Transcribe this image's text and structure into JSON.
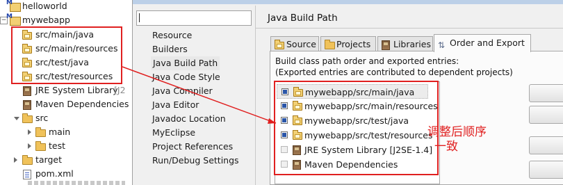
{
  "explorer": {
    "items": [
      {
        "label": "helloworld",
        "icon": "project-icon"
      },
      {
        "label": "mywebapp",
        "icon": "maven-project-icon"
      },
      {
        "label": "src/main/java",
        "icon": "source-folder-icon"
      },
      {
        "label": "src/main/resources",
        "icon": "source-folder-icon"
      },
      {
        "label": "src/test/java",
        "icon": "source-folder-icon"
      },
      {
        "label": "src/test/resources",
        "icon": "source-folder-icon"
      },
      {
        "label": "JRE System Library",
        "suffix": "[J2",
        "icon": "library-icon"
      },
      {
        "label": "Maven Dependencies",
        "icon": "maven-library-icon"
      },
      {
        "label": "src",
        "icon": "folder-icon"
      },
      {
        "label": "main",
        "icon": "folder-icon"
      },
      {
        "label": "test",
        "icon": "folder-icon"
      },
      {
        "label": "target",
        "icon": "folder-icon"
      },
      {
        "label": "pom.xml",
        "icon": "xml-file-icon"
      }
    ]
  },
  "dialog": {
    "filter_value": "",
    "nav": [
      "Resource",
      "Builders",
      "Java Build Path",
      "Java Code Style",
      "Java Compiler",
      "Java Editor",
      "Javadoc Location",
      "MyEclipse",
      "Project References",
      "Run/Debug Settings"
    ],
    "selected_nav": "Java Build Path",
    "heading": "Java Build Path",
    "tabs": [
      "Source",
      "Projects",
      "Libraries",
      "Order and Export"
    ],
    "active_tab": "Order and Export",
    "description_line1": "Build class path order and exported entries:",
    "description_line2": "(Exported entries are contributed to dependent projects)",
    "entries": [
      {
        "label": "mywebapp/src/main/java",
        "checked": true
      },
      {
        "label": "mywebapp/src/main/resources",
        "checked": true
      },
      {
        "label": "mywebapp/src/test/java",
        "checked": true
      },
      {
        "label": "mywebapp/src/test/resources",
        "checked": true
      },
      {
        "label": "JRE System Library [J2SE-1.4]",
        "checked": false
      },
      {
        "label": "Maven Dependencies",
        "checked": false
      }
    ]
  },
  "annotation": {
    "line1": "调整后顺序",
    "line2": "一致",
    "color": "#e02020"
  }
}
